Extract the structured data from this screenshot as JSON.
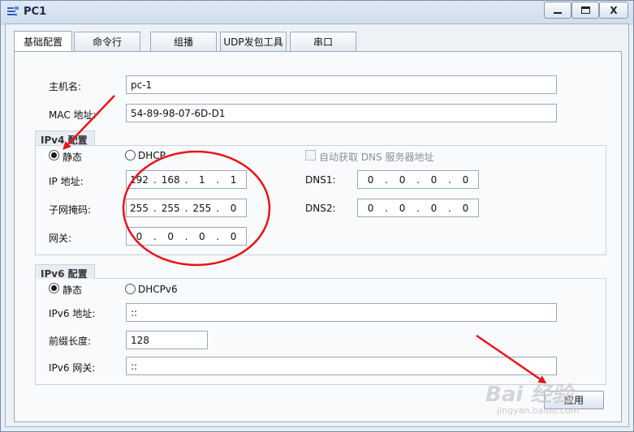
{
  "window": {
    "title": "PC1",
    "minimize": "",
    "maximize": "",
    "close": "X"
  },
  "tabs": [
    {
      "label": "基础配置",
      "active": true
    },
    {
      "label": "命令行"
    },
    {
      "label": "组播"
    },
    {
      "label": "UDP发包工具"
    },
    {
      "label": "串口"
    }
  ],
  "basic": {
    "hostname_label": "主机名:",
    "hostname_value": "pc-1",
    "mac_label": "MAC 地址:",
    "mac_value": "54-89-98-07-6D-D1"
  },
  "ipv4": {
    "group_title": "IPv4 配置",
    "static_label": "静态",
    "dhcp_label": "DHCP",
    "ip_label": "IP 地址:",
    "ip": [
      "192",
      "168",
      "1",
      "1"
    ],
    "mask_label": "子网掩码:",
    "mask": [
      "255",
      "255",
      "255",
      "0"
    ],
    "gateway_label": "网关:",
    "gateway": [
      "0",
      "0",
      "0",
      "0"
    ],
    "auto_dns_label": "自动获取 DNS 服务器地址",
    "dns1_label": "DNS1:",
    "dns1": [
      "0",
      "0",
      "0",
      "0"
    ],
    "dns2_label": "DNS2:",
    "dns2": [
      "0",
      "0",
      "0",
      "0"
    ]
  },
  "ipv6": {
    "group_title": "IPv6 配置",
    "static_label": "静态",
    "dhcp_label": "DHCPv6",
    "addr_label": "IPv6 地址:",
    "addr_value": "::",
    "prefix_label": "前缀长度:",
    "prefix_value": "128",
    "gateway_label": "IPv6 网关:",
    "gateway_value": "::"
  },
  "apply_label": "应用",
  "watermark": {
    "text": "Bai 经验",
    "sub": "jingyan.baidu.com"
  },
  "colors": {
    "annotation": "#e8141b"
  }
}
